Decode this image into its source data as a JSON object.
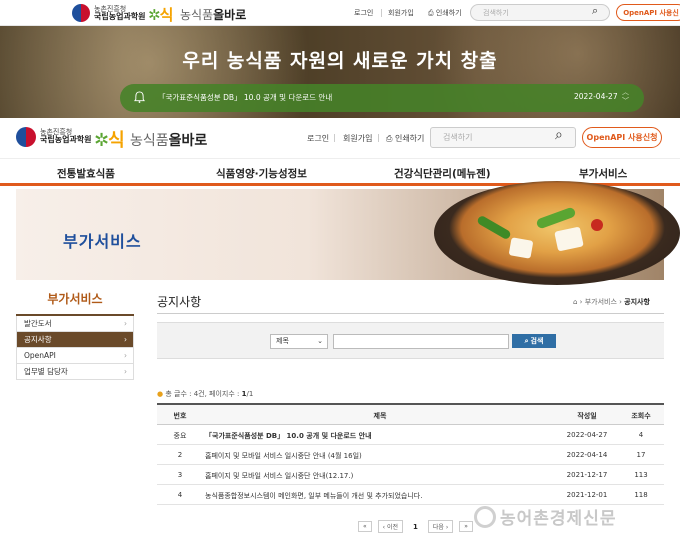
{
  "top": {
    "org_small": "농촌진흥청",
    "org_name": "국립농업과학원",
    "logo_mark": "식",
    "service": "농식품",
    "service_bold": "올바로",
    "login": "로그인",
    "signup": "회원가입",
    "print": "인쇄하기",
    "search_placeholder": "검색하기",
    "api_button": "OpenAPI 사용신"
  },
  "hero": {
    "title": "우리 농식품 자원의 새로운 가치 창출",
    "notice": "「국가표준식품성분 DB」 10.0 공개 및 다운로드 안내",
    "notice_date": "2022-04-27"
  },
  "header": {
    "org_small": "농촌진흥청",
    "org_name": "국립농업과학원",
    "service": "농식품",
    "service_bold": "올바로",
    "login": "로그인",
    "signup": "회원가입",
    "print": "인쇄하기",
    "search_placeholder": "검색하기",
    "api_button": "OpenAPI 사용신청"
  },
  "gnb": [
    "전통발효식품",
    "식품영양·기능성정보",
    "건강식단관리(메뉴젠)",
    "부가서비스"
  ],
  "sub_visual_title": "부가서비스",
  "lnb": {
    "title": "부가서비스",
    "items": [
      {
        "label": "발간도서",
        "active": false
      },
      {
        "label": "공지사항",
        "active": true
      },
      {
        "label": "OpenAPI",
        "active": false
      },
      {
        "label": "업무별 담당자",
        "active": false
      }
    ]
  },
  "page": {
    "title": "공지사항",
    "breadcrumb_parent": "부가서비스",
    "breadcrumb_current": "공지사항"
  },
  "search": {
    "select_value": "제목",
    "input_value": "",
    "button": "검색"
  },
  "summary": {
    "prefix": "총 글수 : 4건, 페이지수 : ",
    "current_page": "1",
    "total_pages": "/1"
  },
  "table": {
    "headers": {
      "no": "번호",
      "title": "제목",
      "date": "작성일",
      "views": "조회수"
    },
    "rows": [
      {
        "no": "중요",
        "title": "「국가표준식품성분 DB」 10.0 공개 및 다운로드 안내",
        "date": "2022-04-27",
        "views": "4"
      },
      {
        "no": "2",
        "title": "홈페이지 및 모바일 서비스 일시중단 안내 (4월 16일)",
        "date": "2022-04-14",
        "views": "17"
      },
      {
        "no": "3",
        "title": "홈페이지 및 모바일 서비스 일시중단 안내(12.17.)",
        "date": "2021-12-17",
        "views": "113"
      },
      {
        "no": "4",
        "title": "농식품종합정보시스템이 메인화면, 일부 메뉴들이 개선 및 추가되었습니다.",
        "date": "2021-12-01",
        "views": "118"
      }
    ]
  },
  "pager": {
    "first": "«",
    "prev": "‹ 이전",
    "current": "1",
    "next": "다음 ›",
    "last": "»"
  },
  "watermark": "농어촌경제신문",
  "colors": {
    "accent": "#e05a1c",
    "brand_brown": "#6a4a2a",
    "search_blue": "#2f6ea5",
    "notice_green": "#46822a"
  }
}
